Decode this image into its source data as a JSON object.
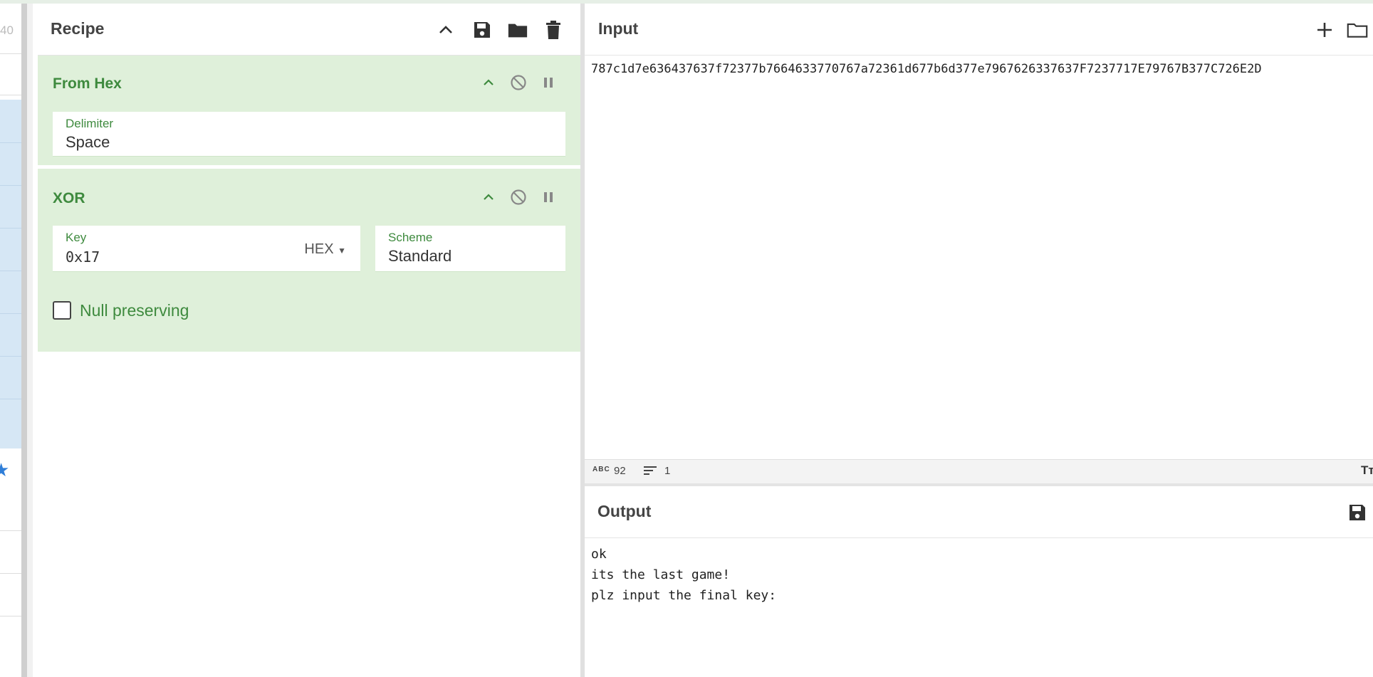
{
  "operations_sidebar": {
    "partial_number": "40"
  },
  "recipe": {
    "title": "Recipe",
    "ops": [
      {
        "name": "From Hex",
        "args": [
          {
            "label": "Delimiter",
            "value": "Space"
          }
        ]
      },
      {
        "name": "XOR",
        "args": [
          {
            "label": "Key",
            "value": "0x17",
            "type": "HEX"
          },
          {
            "label": "Scheme",
            "value": "Standard"
          }
        ],
        "checkbox": {
          "label": "Null preserving",
          "checked": false
        }
      }
    ]
  },
  "input": {
    "title": "Input",
    "text": "787c1d7e636437637f72377b7664633770767a72361d677b6d377e7967626337637F7237717E79767B377C726E2D",
    "status": {
      "length": "92",
      "lines": "1"
    }
  },
  "output": {
    "title": "Output",
    "lines": [
      "ok",
      "its the last game!",
      "plz input the final key:"
    ]
  },
  "colors": {
    "op_background": "#dff0da",
    "op_title": "#3e8a3e",
    "selection_blue": "#d6e7f5"
  }
}
